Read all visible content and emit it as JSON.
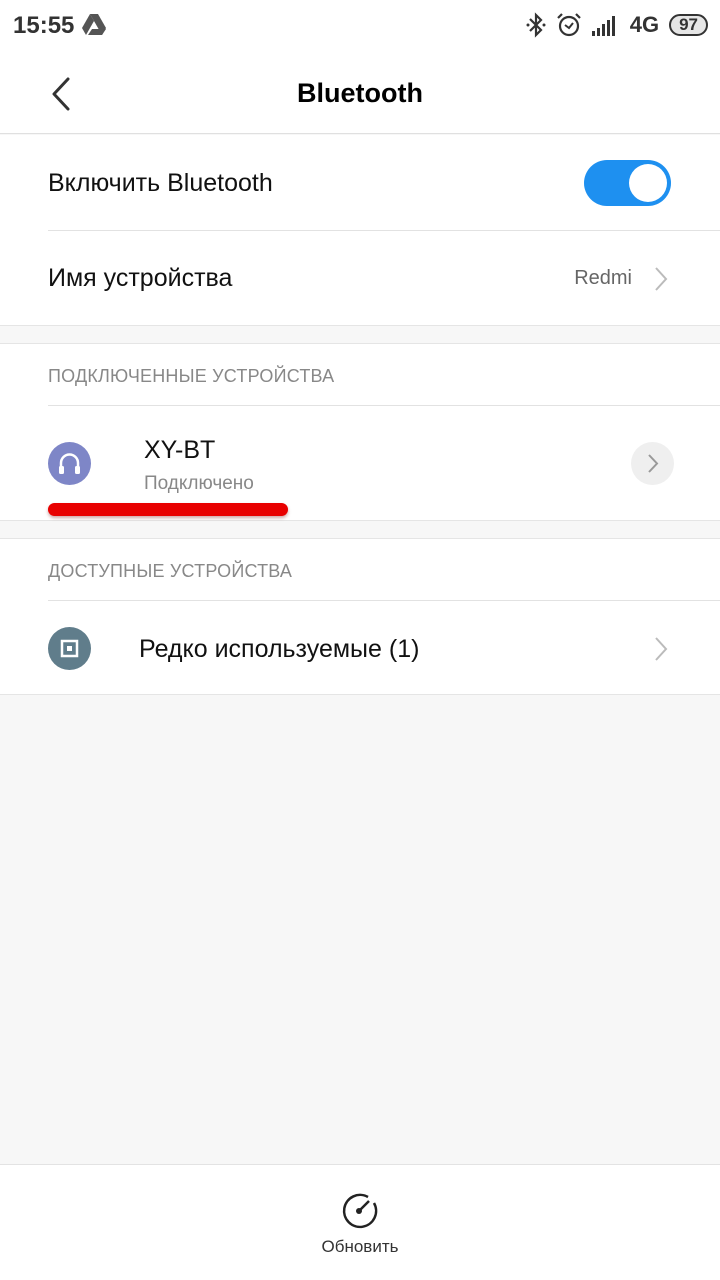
{
  "status_bar": {
    "time": "15:55",
    "left_icons": [
      "google-drive-icon"
    ],
    "right_icons": [
      "bluetooth-icon",
      "alarm-icon",
      "signal-icon"
    ],
    "network": "4G",
    "battery": "97"
  },
  "header": {
    "back_icon": "chevron-left-icon",
    "title": "Bluetooth"
  },
  "settings": {
    "bluetooth_toggle": {
      "label": "Включить Bluetooth",
      "enabled": true,
      "accent": "#1e90f0"
    },
    "device_name": {
      "label": "Имя устройства",
      "value": "Redmi"
    }
  },
  "connected": {
    "section_title": "ПОДКЛЮЧЕННЫЕ УСТРОЙСТВА",
    "devices": [
      {
        "name": "XY-BT",
        "status": "Подключено",
        "icon": "headphones-icon",
        "icon_color": "#7e86c7"
      }
    ]
  },
  "available": {
    "section_title": "ДОСТУПНЫЕ УСТРОЙСТВА",
    "items": [
      {
        "label": "Редко используемые (1)",
        "icon": "device-icon",
        "icon_color": "#607d8b"
      }
    ]
  },
  "annotation": {
    "color": "#e80000"
  },
  "bottom_bar": {
    "refresh_label": "Обновить",
    "refresh_icon": "gauge-icon"
  }
}
